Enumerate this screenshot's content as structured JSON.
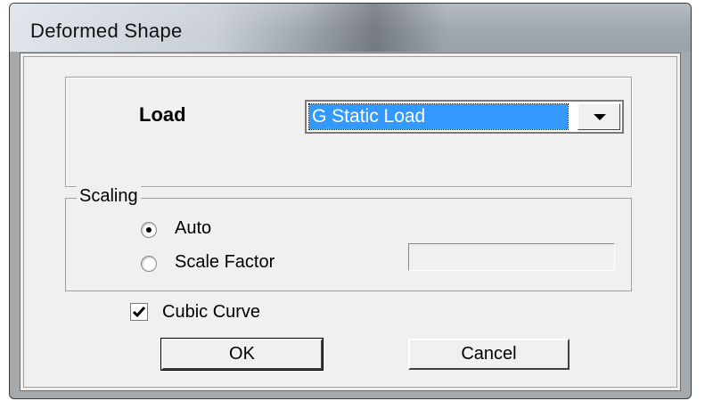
{
  "window": {
    "title": "Deformed Shape"
  },
  "load": {
    "label": "Load",
    "selected": "G Static Load"
  },
  "scaling": {
    "title": "Scaling",
    "options": [
      {
        "label": "Auto",
        "selected": true
      },
      {
        "label": "Scale Factor",
        "selected": false
      }
    ],
    "scale_factor_value": ""
  },
  "cubic_curve": {
    "label": "Cubic Curve",
    "checked": true
  },
  "buttons": {
    "ok": "OK",
    "cancel": "Cancel"
  }
}
